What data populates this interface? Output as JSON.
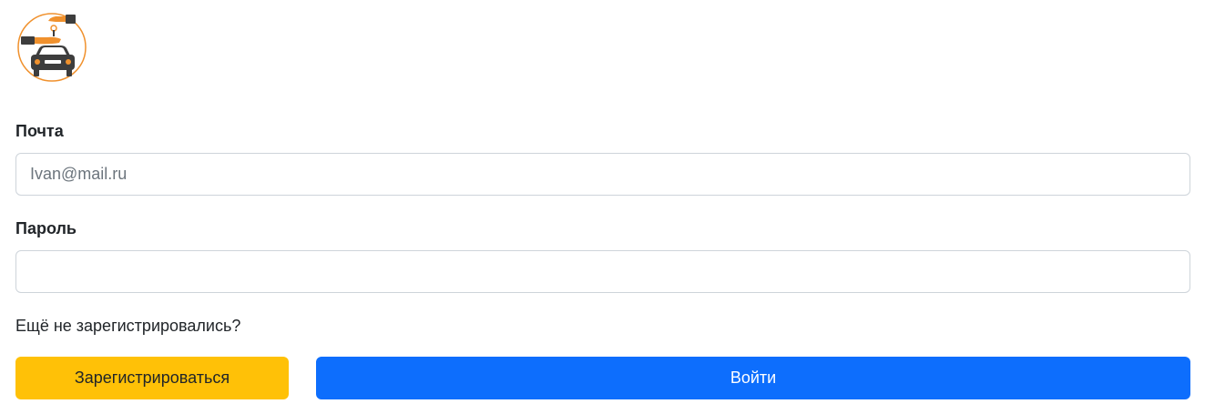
{
  "logo": {
    "icon": "car-keys-handover-logo",
    "accent_color": "#f0912d",
    "dark_color": "#3d3d3d"
  },
  "form": {
    "email": {
      "label": "Почта",
      "placeholder": "Ivan@mail.ru",
      "value": ""
    },
    "password": {
      "label": "Пароль",
      "placeholder": "",
      "value": ""
    },
    "register_hint": "Ещё не зарегистрировались?",
    "register_button": "Зарегистрироваться",
    "login_button": "Войти"
  },
  "colors": {
    "register_button_bg": "#ffc107",
    "login_button_bg": "#0d6efd"
  }
}
